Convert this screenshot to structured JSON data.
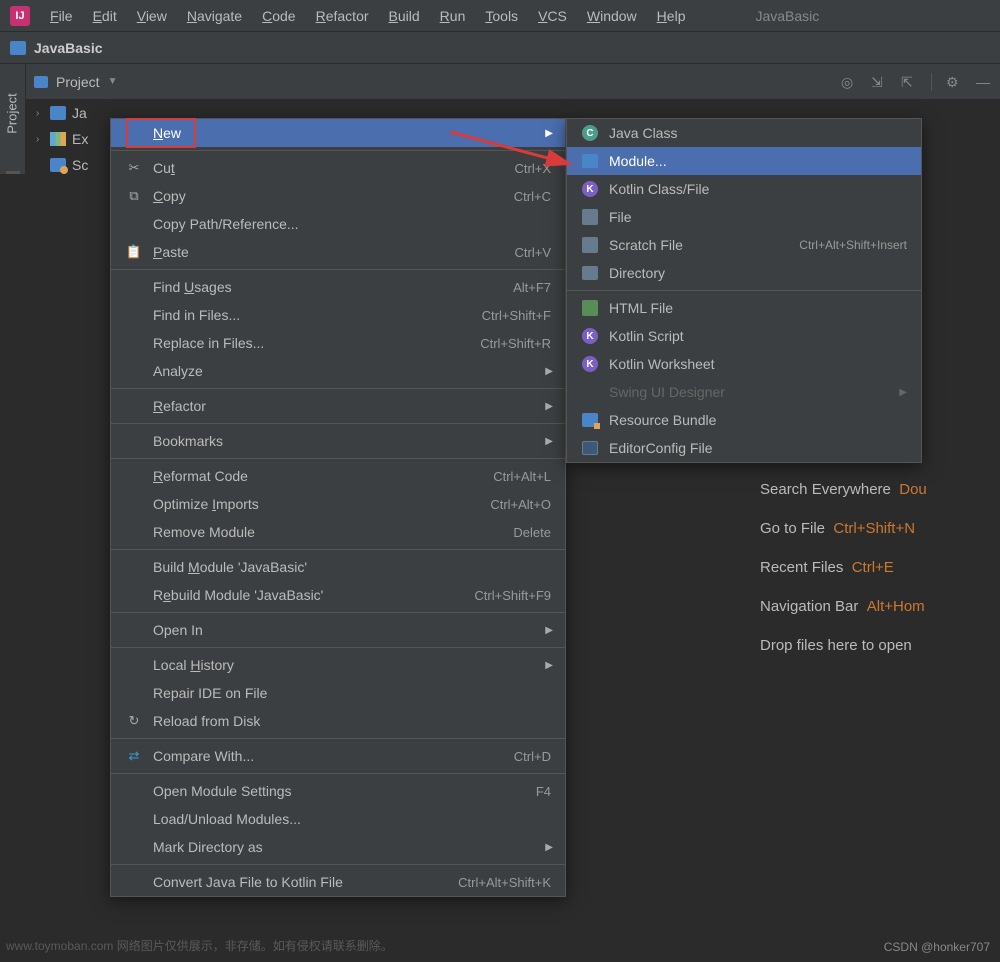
{
  "app_title": "JavaBasic",
  "menubar": [
    "File",
    "Edit",
    "View",
    "Navigate",
    "Code",
    "Refactor",
    "Build",
    "Run",
    "Tools",
    "VCS",
    "Window",
    "Help"
  ],
  "breadcrumb": "JavaBasic",
  "panel": {
    "title": "Project"
  },
  "side_tab": "Project",
  "tree": {
    "r0": "Ja",
    "r1": "Ex",
    "r2": "Sc"
  },
  "ctx": [
    {
      "t": "item",
      "icon": "",
      "label": "New",
      "sc": "",
      "arrow": true,
      "sel": true,
      "u": 0,
      "name": "new"
    },
    {
      "t": "sep"
    },
    {
      "t": "item",
      "icon": "✂",
      "label": "Cut",
      "sc": "Ctrl+X",
      "u": 2,
      "name": "cut"
    },
    {
      "t": "item",
      "icon": "⧉",
      "label": "Copy",
      "sc": "Ctrl+C",
      "u": 0,
      "name": "copy"
    },
    {
      "t": "item",
      "icon": "",
      "label": "Copy Path/Reference...",
      "sc": "",
      "name": "copy-path"
    },
    {
      "t": "item",
      "icon": "📋",
      "label": "Paste",
      "sc": "Ctrl+V",
      "u": 0,
      "name": "paste"
    },
    {
      "t": "sep"
    },
    {
      "t": "item",
      "icon": "",
      "label": "Find Usages",
      "sc": "Alt+F7",
      "u": 5,
      "name": "find-usages"
    },
    {
      "t": "item",
      "icon": "",
      "label": "Find in Files...",
      "sc": "Ctrl+Shift+F",
      "name": "find-in-files"
    },
    {
      "t": "item",
      "icon": "",
      "label": "Replace in Files...",
      "sc": "Ctrl+Shift+R",
      "name": "replace-in-files"
    },
    {
      "t": "item",
      "icon": "",
      "label": "Analyze",
      "sc": "",
      "arrow": true,
      "name": "analyze"
    },
    {
      "t": "sep"
    },
    {
      "t": "item",
      "icon": "",
      "label": "Refactor",
      "sc": "",
      "arrow": true,
      "u": 0,
      "name": "refactor"
    },
    {
      "t": "sep"
    },
    {
      "t": "item",
      "icon": "",
      "label": "Bookmarks",
      "sc": "",
      "arrow": true,
      "name": "bookmarks"
    },
    {
      "t": "sep"
    },
    {
      "t": "item",
      "icon": "",
      "label": "Reformat Code",
      "sc": "Ctrl+Alt+L",
      "u": 0,
      "name": "reformat-code"
    },
    {
      "t": "item",
      "icon": "",
      "label": "Optimize Imports",
      "sc": "Ctrl+Alt+O",
      "u": 9,
      "name": "optimize-imports"
    },
    {
      "t": "item",
      "icon": "",
      "label": "Remove Module",
      "sc": "Delete",
      "name": "remove-module"
    },
    {
      "t": "sep"
    },
    {
      "t": "item",
      "icon": "",
      "label": "Build Module 'JavaBasic'",
      "sc": "",
      "u": 6,
      "name": "build-module"
    },
    {
      "t": "item",
      "icon": "",
      "label": "Rebuild Module 'JavaBasic'",
      "sc": "Ctrl+Shift+F9",
      "u": 1,
      "name": "rebuild-module"
    },
    {
      "t": "sep"
    },
    {
      "t": "item",
      "icon": "",
      "label": "Open In",
      "sc": "",
      "arrow": true,
      "name": "open-in"
    },
    {
      "t": "sep"
    },
    {
      "t": "item",
      "icon": "",
      "label": "Local History",
      "sc": "",
      "arrow": true,
      "u": 6,
      "name": "local-history"
    },
    {
      "t": "item",
      "icon": "",
      "label": "Repair IDE on File",
      "sc": "",
      "name": "repair-ide"
    },
    {
      "t": "item",
      "icon": "↻",
      "label": "Reload from Disk",
      "sc": "",
      "name": "reload-disk"
    },
    {
      "t": "sep"
    },
    {
      "t": "item",
      "icon": "⇄",
      "label": "Compare With...",
      "sc": "Ctrl+D",
      "name": "compare-with",
      "iconColor": "#3c9dd0"
    },
    {
      "t": "sep"
    },
    {
      "t": "item",
      "icon": "",
      "label": "Open Module Settings",
      "sc": "F4",
      "name": "module-settings"
    },
    {
      "t": "item",
      "icon": "",
      "label": "Load/Unload Modules...",
      "sc": "",
      "name": "load-unload"
    },
    {
      "t": "item",
      "icon": "",
      "label": "Mark Directory as",
      "sc": "",
      "arrow": true,
      "name": "mark-directory"
    },
    {
      "t": "sep"
    },
    {
      "t": "item",
      "icon": "",
      "label": "Convert Java File to Kotlin File",
      "sc": "Ctrl+Alt+Shift+K",
      "name": "convert-kotlin"
    }
  ],
  "sub": [
    {
      "icon": "b-c",
      "txt": "C",
      "label": "Java Class",
      "name": "java-class"
    },
    {
      "icon": "b-m",
      "label": "Module...",
      "sel": true,
      "name": "module"
    },
    {
      "icon": "b-k",
      "txt": "K",
      "label": "Kotlin Class/File",
      "name": "kotlin-class"
    },
    {
      "icon": "b-f",
      "label": "File",
      "name": "file"
    },
    {
      "icon": "b-f",
      "label": "Scratch File",
      "sc": "Ctrl+Alt+Shift+Insert",
      "name": "scratch-file"
    },
    {
      "icon": "b-d",
      "label": "Directory",
      "name": "directory"
    },
    {
      "t": "sep"
    },
    {
      "icon": "b-h",
      "label": "HTML File",
      "name": "html-file"
    },
    {
      "icon": "b-k",
      "txt": "K",
      "label": "Kotlin Script",
      "name": "kotlin-script"
    },
    {
      "icon": "b-k",
      "txt": "K",
      "label": "Kotlin Worksheet",
      "name": "kotlin-worksheet"
    },
    {
      "label": "Swing UI Designer",
      "dis": true,
      "arrow": true,
      "name": "swing-ui"
    },
    {
      "icon": "b-r",
      "label": "Resource Bundle",
      "name": "resource-bundle"
    },
    {
      "icon": "b-e",
      "label": "EditorConfig File",
      "name": "editorconfig"
    }
  ],
  "hints": [
    {
      "label": "Search Everywhere",
      "key": "Dou"
    },
    {
      "label": "Go to File",
      "key": "Ctrl+Shift+N"
    },
    {
      "label": "Recent Files",
      "key": "Ctrl+E"
    },
    {
      "label": "Navigation Bar",
      "key": "Alt+Hom"
    },
    {
      "label": "Drop files here to open"
    }
  ],
  "watermark": "www.toymoban.com 网络图片仅供展示，非存储。如有侵权请联系删除。",
  "credit": "CSDN @honker707"
}
